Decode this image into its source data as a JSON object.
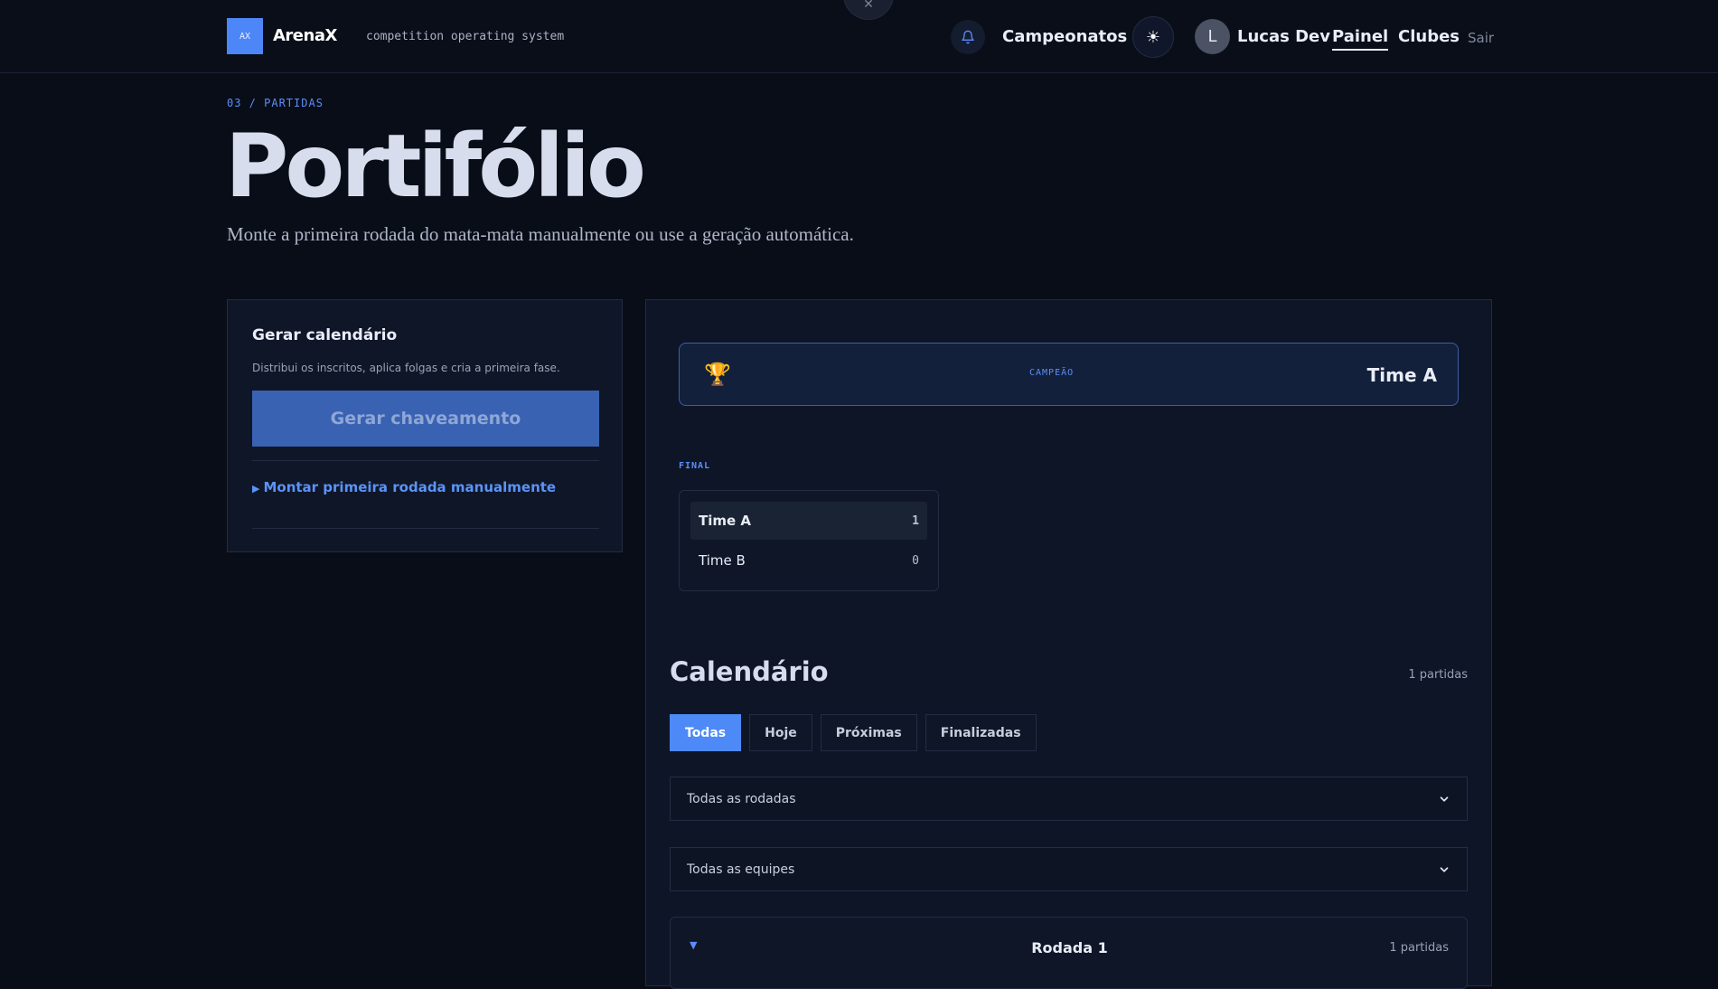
{
  "header": {
    "top_close_icon": "✕",
    "logo_text": "AX",
    "brand": "ArenaX",
    "tagline": "competition operating system",
    "campeonatos": "Campeonatos",
    "theme_icon": "☀",
    "avatar_letter": "L",
    "user_name": "Lucas Dev",
    "painel": "Painel",
    "clubes": "Clubes",
    "sair": "Sair"
  },
  "hero": {
    "breadcrumb": "03 / PARTIDAS",
    "title": "Portifólio",
    "subtitle": "Monte a primeira rodada do mata-mata manualmente ou use a geração automática."
  },
  "generate": {
    "title": "Gerar calendário",
    "description": "Distribui os inscritos, aplica folgas e cria a primeira fase.",
    "button": "Gerar chaveamento",
    "manual_link": "Montar primeira rodada manualmente"
  },
  "bracket": {
    "champion_label": "CAMPEÃO",
    "champion_name": "Time A",
    "trophy_icon": "🏆",
    "final_label": "FINAL",
    "match": {
      "team_a": "Time A",
      "score_a": "1",
      "team_b": "Time B",
      "score_b": "0"
    }
  },
  "calendar": {
    "title": "Calendário",
    "count": "1 partidas",
    "filters": [
      "Todas",
      "Hoje",
      "Próximas",
      "Finalizadas"
    ],
    "round_select": "Todas as rodadas",
    "team_select": "Todas as equipes",
    "round": {
      "title": "Rodada 1",
      "count": "1 partidas"
    }
  },
  "colors": {
    "accent": "#4d8af8",
    "background": "#090d18",
    "panel": "#0f1628"
  }
}
